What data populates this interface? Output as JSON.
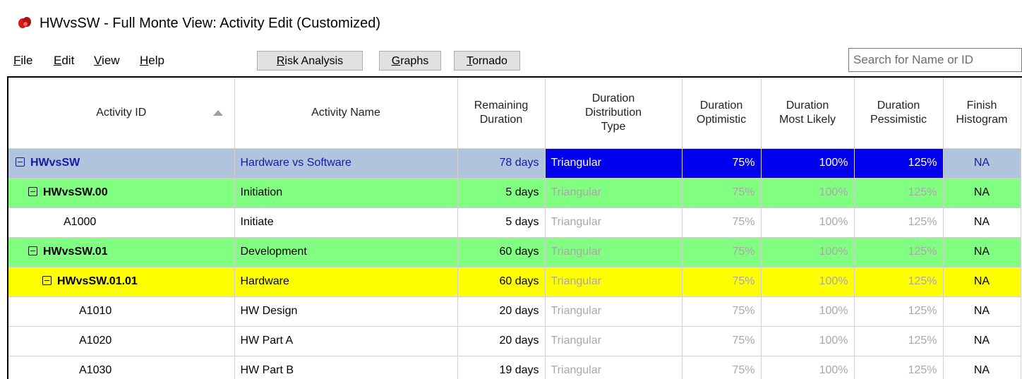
{
  "window": {
    "title": "HWvsSW - Full Monte View: Activity Edit (Customized)",
    "icon": "full-monte-app-icon"
  },
  "menu": [
    {
      "label": "File",
      "accel": "F",
      "rest": "ile"
    },
    {
      "label": "Edit",
      "accel": "E",
      "rest": "dit"
    },
    {
      "label": "View",
      "accel": "V",
      "rest": "iew"
    },
    {
      "label": "Help",
      "accel": "H",
      "rest": "elp"
    }
  ],
  "toolbar": {
    "risk_accel": "R",
    "risk_rest": "isk Analysis",
    "graphs_accel": "G",
    "graphs_rest": "raphs",
    "tornado_accel": "T",
    "tornado_rest": "ornado",
    "search_placeholder": "Search for Name or ID"
  },
  "columns": {
    "id": "Activity ID",
    "name": "Activity Name",
    "remaining_1": "Remaining",
    "remaining_2": "Duration",
    "dist_1": "Duration",
    "dist_2": "Distribution",
    "dist_3": "Type",
    "opt_1": "Duration",
    "opt_2": "Optimistic",
    "ml_1": "Duration",
    "ml_2": "Most Likely",
    "pes_1": "Duration",
    "pes_2": "Pessimistic",
    "fin_1": "Finish",
    "fin_2": "Histogram"
  },
  "rows": [
    {
      "id": "HWvsSW",
      "name": "Hardware vs Software",
      "remaining": "78 days",
      "dist": "Triangular",
      "opt": "75%",
      "ml": "100%",
      "pes": "125%",
      "finish": "NA"
    },
    {
      "id": "HWvsSW.00",
      "name": "Initiation",
      "remaining": "5 days",
      "dist": "Triangular",
      "opt": "75%",
      "ml": "100%",
      "pes": "125%",
      "finish": "NA"
    },
    {
      "id": "A1000",
      "name": "Initiate",
      "remaining": "5 days",
      "dist": "Triangular",
      "opt": "75%",
      "ml": "100%",
      "pes": "125%",
      "finish": "NA"
    },
    {
      "id": "HWvsSW.01",
      "name": "Development",
      "remaining": "60 days",
      "dist": "Triangular",
      "opt": "75%",
      "ml": "100%",
      "pes": "125%",
      "finish": "NA"
    },
    {
      "id": "HWvsSW.01.01",
      "name": "Hardware",
      "remaining": "60 days",
      "dist": "Triangular",
      "opt": "75%",
      "ml": "100%",
      "pes": "125%",
      "finish": "NA"
    },
    {
      "id": "A1010",
      "name": "HW Design",
      "remaining": "20 days",
      "dist": "Triangular",
      "opt": "75%",
      "ml": "100%",
      "pes": "125%",
      "finish": "NA"
    },
    {
      "id": "A1020",
      "name": "HW Part A",
      "remaining": "20 days",
      "dist": "Triangular",
      "opt": "75%",
      "ml": "100%",
      "pes": "125%",
      "finish": "NA"
    },
    {
      "id": "A1030",
      "name": "HW Part B",
      "remaining": "19 days",
      "dist": "Triangular",
      "opt": "75%",
      "ml": "100%",
      "pes": "125%",
      "finish": "NA"
    }
  ],
  "colors": {
    "project_row": "#b0c4de",
    "wbs_green": "#80ff80",
    "wbs_yellow": "#ffff00",
    "selection": "#0000ee"
  }
}
